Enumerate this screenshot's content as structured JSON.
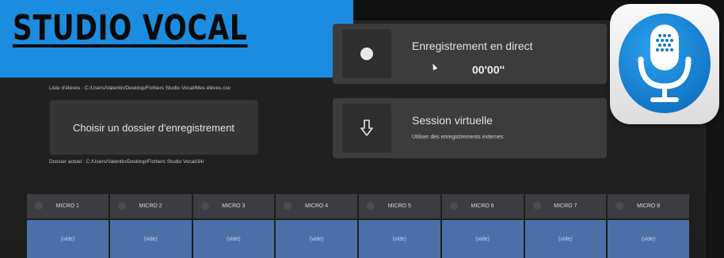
{
  "banner": {
    "title": "STUDIO VOCAL"
  },
  "left_panel": {
    "students_list_path": "Liste d'élèves : C:/Users/Valentin/Desktop/Fichiers Studio Vocal/Mes élèves.csv",
    "choose_folder_label": "Choisir un dossier d'enregistrement",
    "current_folder_path": "Dossier actuel : C:/Users/Valentin/Desktop/Fichiers Studio Vocal/34/"
  },
  "live_recording": {
    "label": "Enregistrement en direct",
    "timer": "00'00''"
  },
  "virtual_session": {
    "label": "Session virtuelle",
    "subtitle": "Utiliser des enregistrements externes"
  },
  "micros": [
    {
      "name": "MICRO 1",
      "slot": "(vide)"
    },
    {
      "name": "MICRO 2",
      "slot": "(vide)"
    },
    {
      "name": "MICRO 3",
      "slot": "(vide)"
    },
    {
      "name": "MICRO 4",
      "slot": "(vide)"
    },
    {
      "name": "MICRO 5",
      "slot": "(vide)"
    },
    {
      "name": "MICRO 6",
      "slot": "(vide)"
    },
    {
      "name": "MICRO 7",
      "slot": "(vide)"
    },
    {
      "name": "MICRO 8",
      "slot": "(vide)"
    }
  ],
  "icons": {
    "app_icon": "microphone-icon",
    "record": "record-dot-icon",
    "import": "arrow-down-icon"
  },
  "colors": {
    "banner": "#1b8ce0",
    "app_icon_disc": "#1477c8",
    "micro_slot": "#4c6fa8",
    "panel": "#3c3c3c"
  }
}
